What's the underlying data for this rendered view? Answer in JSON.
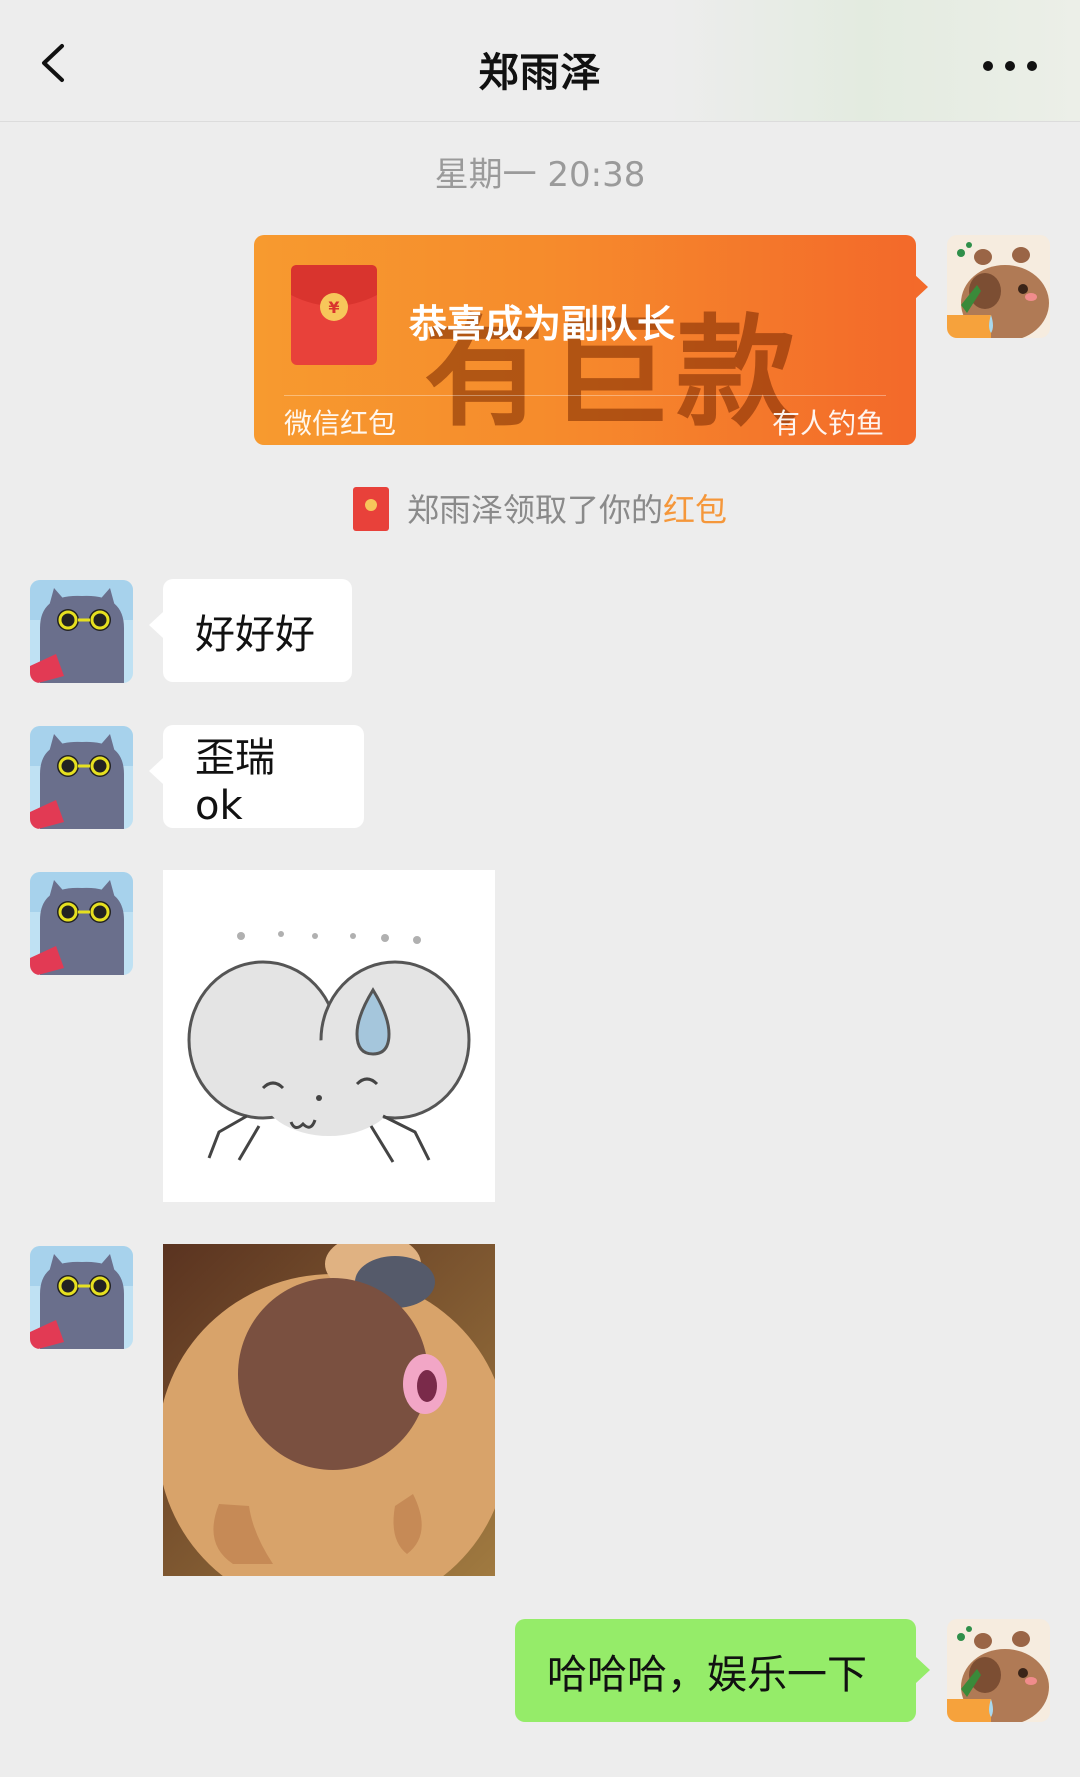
{
  "header": {
    "title": "郑雨泽",
    "back_icon": "chevron-left-icon",
    "more_icon": "more-dots-icon"
  },
  "chat": {
    "timestamp": "星期一 20:38",
    "red_packet": {
      "greeting": "恭喜成为副队长",
      "watermark": "有巨款",
      "label": "微信红包",
      "source": "有人钓鱼",
      "colors": {
        "start": "#f79a2f",
        "end": "#f3692a"
      }
    },
    "system_note": {
      "prefix": "郑雨泽领取了你的",
      "highlight": "红包"
    },
    "messages": [
      {
        "from": "contact",
        "text": "好好好"
      },
      {
        "from": "contact",
        "text": "歪瑞 ok"
      },
      {
        "from": "contact",
        "sticker": "crying-mouse-sticker"
      },
      {
        "from": "contact",
        "sticker": "bear-face-sticker"
      },
      {
        "from": "me",
        "text": "哈哈哈，娱乐一下"
      }
    ]
  },
  "colors": {
    "background": "#ededed",
    "my_bubble": "#95ec69",
    "their_bubble": "#ffffff",
    "highlight": "#f5973a"
  }
}
